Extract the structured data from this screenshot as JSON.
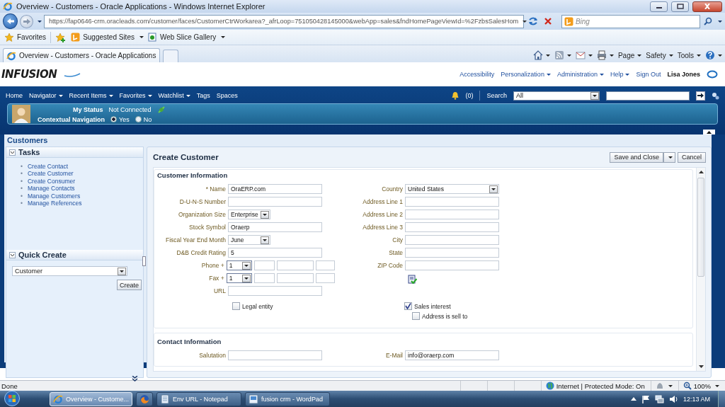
{
  "window": {
    "title": "Overview - Customers - Oracle Applications - Windows Internet Explorer"
  },
  "address_bar": {
    "url": "https://fap0646-crm.oracleads.com/customer/faces/CustomerCtrWorkarea?_afrLoop=751050428145000&webApp=sales&fndHomePageViewId=%2FzbsSalesHom",
    "search_placeholder": "Bing"
  },
  "favorites_bar": {
    "favorites": "Favorites",
    "items": [
      "Suggested Sites",
      "Web Slice Gallery"
    ]
  },
  "browser_tab": {
    "title": "Overview - Customers - Oracle Applications"
  },
  "command_bar": {
    "items": [
      "Page",
      "Safety",
      "Tools"
    ]
  },
  "app_header": {
    "logo": "INFUSION",
    "user": "Lisa Jones",
    "links": [
      {
        "label": "Accessibility",
        "menu": false
      },
      {
        "label": "Personalization",
        "menu": true
      },
      {
        "label": "Administration",
        "menu": true
      },
      {
        "label": "Help",
        "menu": true
      },
      {
        "label": "Sign Out",
        "menu": false
      }
    ]
  },
  "nav": {
    "items": [
      {
        "label": "Home",
        "menu": false
      },
      {
        "label": "Navigator",
        "menu": true
      },
      {
        "label": "Recent Items",
        "menu": true
      },
      {
        "label": "Favorites",
        "menu": true
      },
      {
        "label": "Watchlist",
        "menu": true
      },
      {
        "label": "Tags",
        "menu": false
      },
      {
        "label": "Spaces",
        "menu": false
      }
    ],
    "notifications": "(0)",
    "search_label": "Search",
    "search_scope": "All"
  },
  "status_panel": {
    "label": "My Status",
    "status": "Not Connected",
    "contextual_label": "Contextual Navigation",
    "options": [
      {
        "label": "Yes",
        "selected": true
      },
      {
        "label": "No",
        "selected": false
      }
    ]
  },
  "page_title": "Customers",
  "tasks": {
    "title": "Tasks",
    "marker": "•",
    "items": [
      "Create Contact",
      "Create Customer",
      "Create Consumer",
      "Manage Contacts",
      "Manage Customers",
      "Manage References"
    ]
  },
  "quick_create": {
    "title": "Quick Create",
    "value": "Customer",
    "button": "Create"
  },
  "form": {
    "title": "Create Customer",
    "save_button": "Save and Close",
    "cancel_button": "Cancel",
    "sections": [
      {
        "title": "Customer Information",
        "left_fields": [
          {
            "label": "* Name",
            "kind": "text",
            "value": "OraERP.com"
          },
          {
            "label": "D-U-N-S Number",
            "kind": "text"
          },
          {
            "label": "Organization Size",
            "kind": "short_select",
            "value": "Enterprise"
          },
          {
            "label": "Stock Symbol",
            "kind": "text",
            "value": "Oraerp"
          },
          {
            "label": "Fiscal Year End Month",
            "kind": "short_select",
            "value": "June"
          },
          {
            "label": "D&B Credit Rating",
            "kind": "text",
            "value": "5"
          },
          {
            "label": "Phone +",
            "kind": "phone",
            "code": "1"
          },
          {
            "label": "Fax +",
            "kind": "phone",
            "code": "1"
          },
          {
            "label": "URL",
            "kind": "text"
          }
        ],
        "right_fields": [
          {
            "label": "Country",
            "kind": "select",
            "value": "United States"
          },
          {
            "label": "Address Line 1",
            "kind": "text"
          },
          {
            "label": "Address Line 2",
            "kind": "text"
          },
          {
            "label": "Address Line 3",
            "kind": "text"
          },
          {
            "label": "City",
            "kind": "text"
          },
          {
            "label": "State",
            "kind": "text"
          },
          {
            "label": "ZIP Code",
            "kind": "text"
          }
        ],
        "left_checks": [
          {
            "label": "Legal entity",
            "checked": false
          }
        ],
        "right_checks": [
          {
            "label": "Sales interest",
            "checked": true,
            "children": [
              {
                "label": "Address is sell to",
                "checked": false
              }
            ]
          }
        ]
      },
      {
        "title": "Contact Information",
        "left_fields": [
          {
            "label": "Salutation",
            "kind": "text"
          }
        ],
        "right_fields": [
          {
            "label": "E-Mail",
            "kind": "text",
            "value": "info@oraerp.com"
          }
        ]
      }
    ]
  },
  "status_bar": {
    "status": "Done",
    "zone": "Internet | Protected Mode: On",
    "zoom": "100%"
  },
  "taskbar": {
    "clock": "12:13 AM",
    "items": [
      {
        "kind": "browser",
        "label": "Overview - Custome...",
        "selected": true
      },
      {
        "kind": "firefox",
        "selected": false
      },
      {
        "kind": "notepad",
        "label": "Env URL - Notepad",
        "selected": false
      },
      {
        "kind": "wordpad",
        "label": "fusion crm - WordPad",
        "selected": false
      }
    ]
  }
}
